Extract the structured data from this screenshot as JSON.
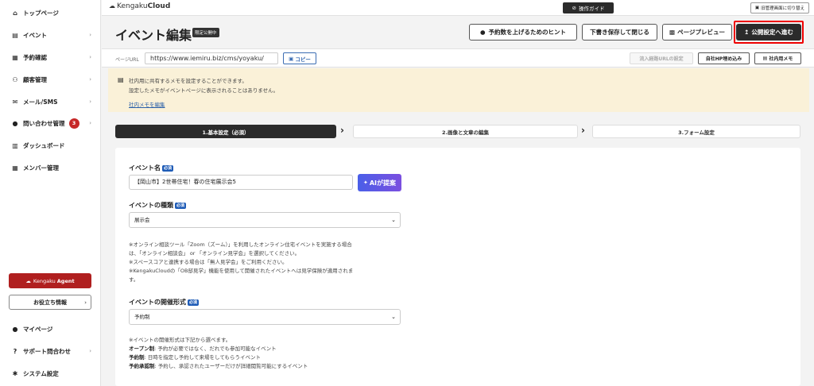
{
  "sidebar": {
    "items": [
      {
        "icon": "home-icon",
        "glyph": "⌂",
        "label": "トップページ"
      },
      {
        "icon": "document-icon",
        "glyph": "▤",
        "label": "イベント"
      },
      {
        "icon": "calendar-icon",
        "glyph": "▦",
        "label": "予約確認"
      },
      {
        "icon": "users-icon",
        "glyph": "⚇",
        "label": "顧客管理"
      },
      {
        "icon": "mail-icon",
        "glyph": "✉",
        "label": "メール/SMS"
      },
      {
        "icon": "chat-icon",
        "glyph": "●",
        "label": "問い合わせ管理",
        "badge": "3"
      },
      {
        "icon": "chart-icon",
        "glyph": "▥",
        "label": "ダッシュボード"
      },
      {
        "icon": "grid-icon",
        "glyph": "▦",
        "label": "メンバー管理"
      }
    ],
    "agent_button": {
      "prefix": "KengakuAgent",
      "brand": "Kengaku",
      "suffix": "Agent"
    },
    "help_button": "お役立ち情報",
    "bottom_items": [
      {
        "icon": "person-icon",
        "glyph": "●",
        "label": "マイページ"
      },
      {
        "icon": "question-icon",
        "glyph": "?",
        "label": "サポート問合わせ"
      },
      {
        "icon": "gear-icon",
        "glyph": "✱",
        "label": "システム設定"
      }
    ]
  },
  "topbar": {
    "logo_pre": "Kengaku",
    "logo_bold": "Cloud",
    "guide": "操作ガイド",
    "switch": "旧管理画面に切り替え"
  },
  "header": {
    "title": "イベント編集",
    "badge": "限定公開中",
    "hint": "予約数を上げるためのヒント",
    "save_close": "下書き保存して閉じる",
    "preview": "ページプレビュー",
    "publish": "公開設定へ進む"
  },
  "urlbar": {
    "label": "ページURL",
    "url": "https://www.iemiru.biz/cms/yoyaku/",
    "copy": "コピー",
    "inflow": "流入経路URLの設定",
    "embed": "自社HP埋め込み",
    "memo": "社内用メモ"
  },
  "memo": {
    "line1": "社内用に共有するメモを設定することができます。",
    "line2": "設定したメモがイベントページに表示されることはありません。",
    "link": "社内メモを編集"
  },
  "steps": [
    "1.基本設定（必須）",
    "2.画像と文章の編集",
    "3.フォーム設定"
  ],
  "form": {
    "required": "必須",
    "name_label": "イベント名",
    "name_value": "【岡山市】2世帯住宅！春の住宅展示会5",
    "ai_button": "AIが提案",
    "type_label": "イベントの種類",
    "type_value": "展示会",
    "type_notes": [
      "※オンライン相談ツール「Zoom（ズーム）」を利用したオンライン住宅イベントを実施する場合",
      "は、「オンライン相談会」 or 「オンライン見学会」を選択してください。",
      "※スペースコアと連携する場合は「無人見学会」をご利用ください。",
      "※KengakuCloudの「OB邸見学」機能を使用して開催されたイベントへは見学保険が適用されま",
      "す。"
    ],
    "format_label": "イベントの開催形式",
    "format_value": "予約制",
    "format_notes": {
      "intro": "※イベントの開催形式は下記から選べます。",
      "open_b": "オープン制",
      "open_t": ": 予約が必要ではなく、だれでも参加可能なイベント",
      "res_b": "予約制",
      "res_t": ": 日時を指定し予約して来場をしてもらうイベント",
      "app_b": "予約承認制",
      "app_t": ": 予約し、承認されたユーザーだけが詳細閲覧可能にするイベント"
    }
  }
}
